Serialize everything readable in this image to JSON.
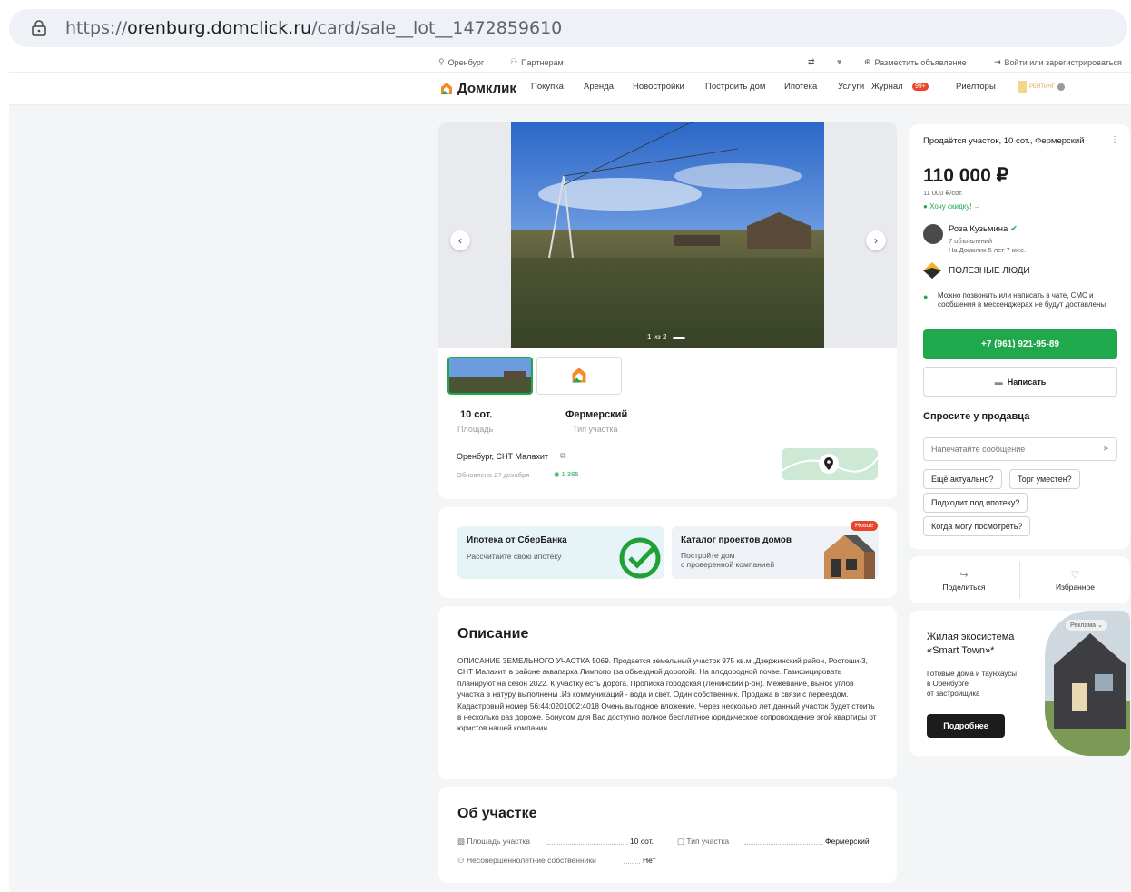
{
  "browser": {
    "url_host": "orenburg.domclick.ru",
    "url_prefix": "https://",
    "url_path": "/card/sale__lot__1472859610"
  },
  "topbar": {
    "city": "Оренбург",
    "partners": "Партнерам",
    "post_ad": "Разместить объявление",
    "login": "Войти или зарегистрироваться"
  },
  "nav": {
    "logo": "Домклик",
    "items": [
      "Покупка",
      "Аренда",
      "Новостройки",
      "Построить дом",
      "Ипотека",
      "Услуги",
      "Журнал",
      "Риелторы"
    ],
    "journal_badge": "99+",
    "rating_label": "РЕЙТИНГ"
  },
  "gallery": {
    "counter": "1 из 2"
  },
  "summary": {
    "area_value": "10 сот.",
    "area_label": "Площадь",
    "type_value": "Фермерский",
    "type_label": "Тип участка",
    "address": "Оренбург, СНТ Малахит",
    "updated": "Обновлено 27 декабря",
    "views": "1 385"
  },
  "promo": {
    "mortgage_title": "Ипотека от СберБанка",
    "mortgage_sub": "Рассчитайте свою ипотеку",
    "catalog_title": "Каталог проектов домов",
    "catalog_sub1": "Постройте дом",
    "catalog_sub2": "с проверенной компанией",
    "new_badge": "Новое"
  },
  "description": {
    "heading": "Описание",
    "text": "ОПИСАНИЕ ЗЕМЕЛЬНОГО УЧАСТКА 5069. Продается земельный участок 975 кв.м.,Дзержинский район, Ростоши-3, СНТ Малахит, в районе аквапарка Лимпопо (за объездной дорогой). На плодородной почве. Газифицировать планируют на сезон 2022. К участку есть дорога. Прописка городская (Ленинский р-он). Межевание, вынос углов участка в натуру выполнены .Из коммуникаций - вода и свет. Один собственник. Продажа в связи с переездом. Кадастровый номер 56:44:0201002:4018 Очень выгодное вложение. Через несколько лет данный участок будет стоить в несколько раз дороже. Бонусом для Вас доступно полное бесплатное юридическое сопровождение этой квартиры от юристов нашей компании."
  },
  "about": {
    "heading": "Об участке",
    "area_label": "Площадь участка",
    "area_value": "10 сот.",
    "type_label": "Тип участка",
    "type_value": "Фермерский",
    "minors_label": "Несовершеннолетние собственники",
    "minors_value": "Нет"
  },
  "sidebar": {
    "title": "Продаётся участок, 10 сот., Фермерский",
    "price": "110 000 ₽",
    "price_per": "11 000 ₽/сот.",
    "discount": "Хочу скидку! →",
    "seller_name": "Роза Кузьмина",
    "seller_ads": "7 объявлений",
    "seller_since": "На Домклик 5 лет 7 мес.",
    "useful_people": "ПОЛЕЗНЫЕ ЛЮДИ",
    "contact_note": "Можно позвонить или написать в чате, СМС и сообщения в мессенджерах не будут доставлены",
    "phone": "+7 (961) 921-95-89",
    "write": "Написать",
    "ask_heading": "Спросите у продавца",
    "message_placeholder": "Напечатайте сообщение",
    "chips": [
      "Ещё актуально?",
      "Торг уместен?",
      "Подходит под ипотеку?",
      "Когда могу посмотреть?"
    ],
    "share": "Поделиться",
    "favorite": "Избранное"
  },
  "ad": {
    "label": "Реклама",
    "title1": "Жилая экосистема",
    "title2": "«Smart Town»*",
    "sub1": "Готовые дома и таунхаусы",
    "sub2": "в Оренбурге",
    "sub3": "от застройщика",
    "button": "Подробнее"
  },
  "colors": {
    "accent_green": "#1fa84c",
    "badge_red": "#e8462b",
    "brand_orange": "#f28c28"
  }
}
